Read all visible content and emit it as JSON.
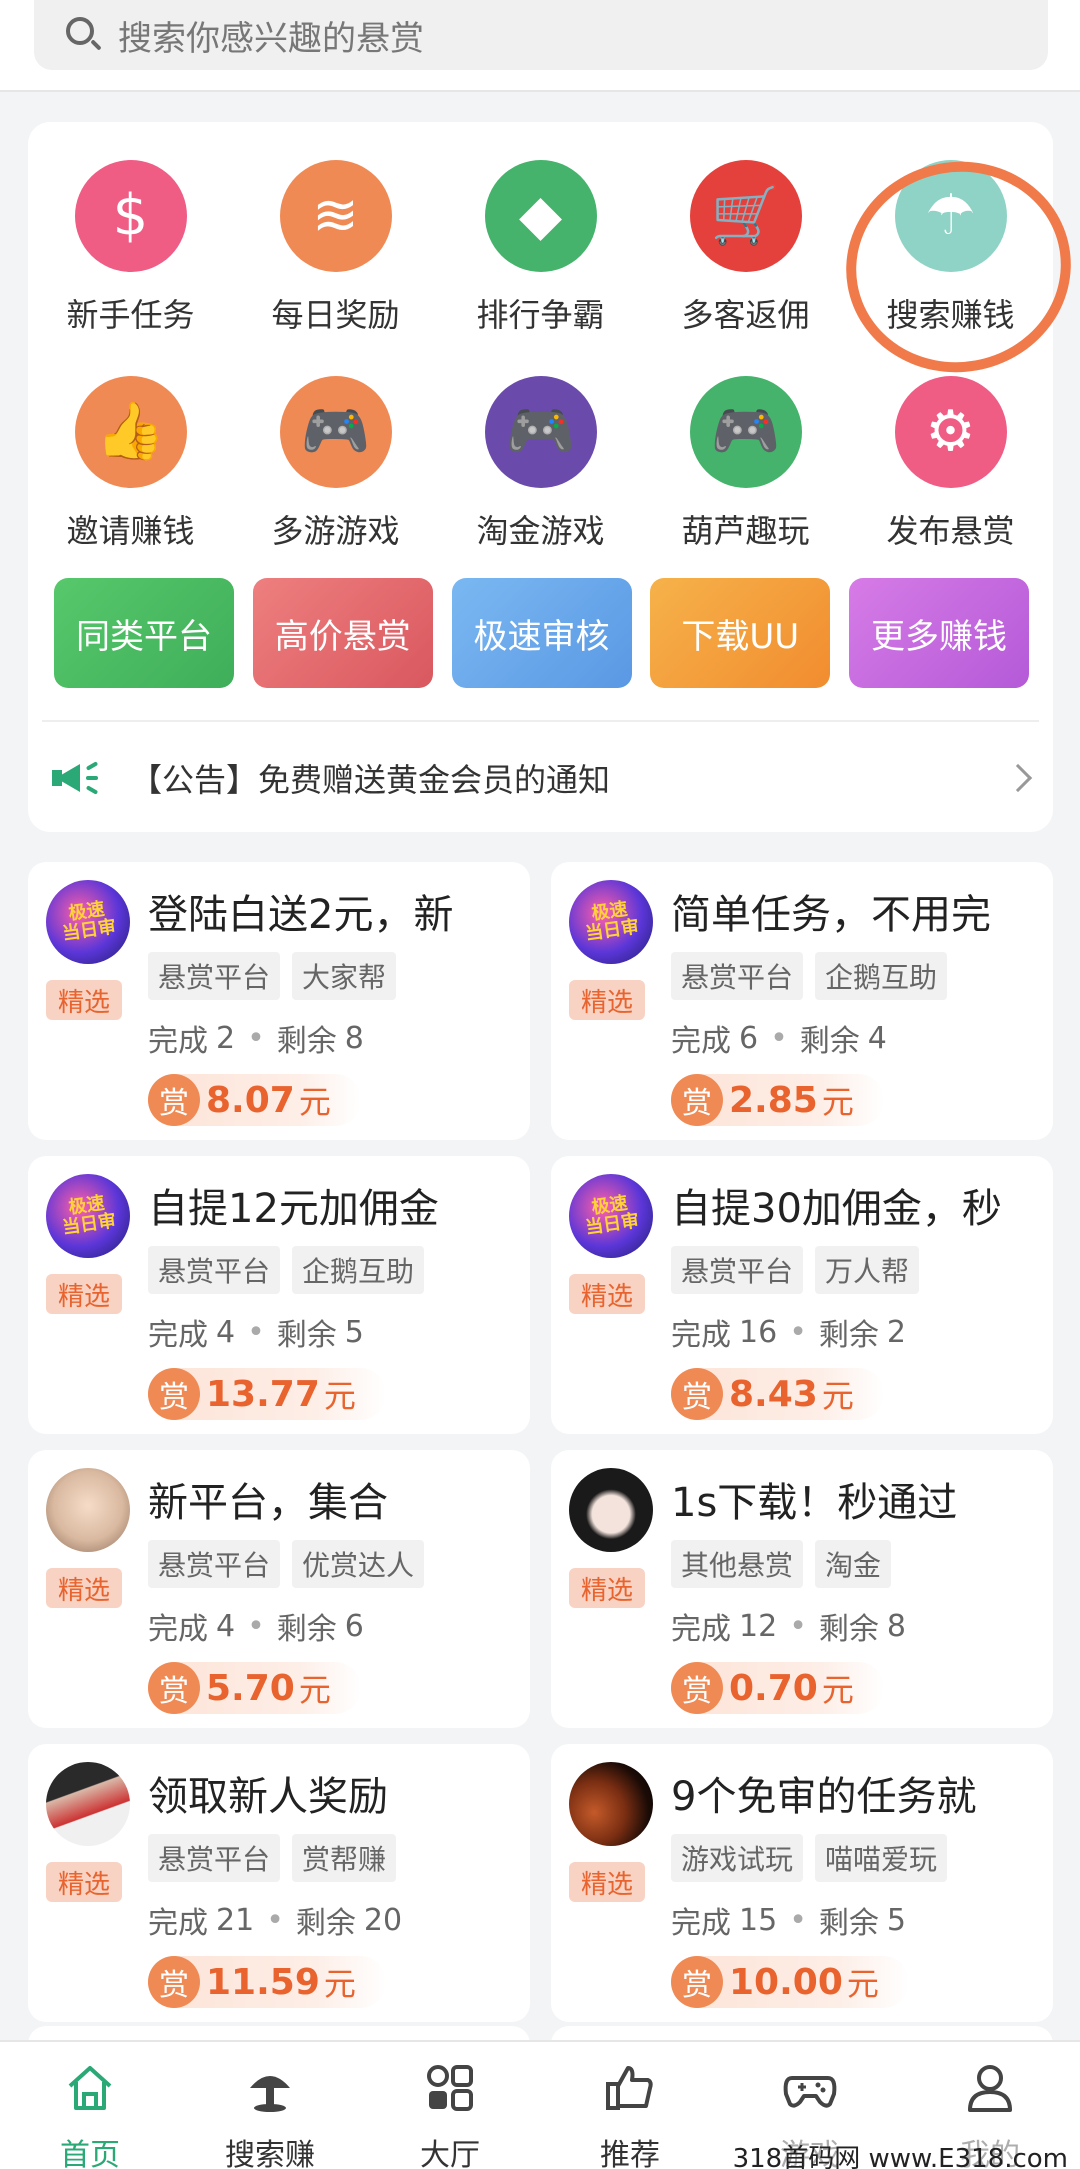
{
  "search": {
    "placeholder": "搜索你感兴趣的悬赏"
  },
  "features": [
    {
      "label": "新手任务",
      "color": "#ef5c84",
      "glyph": "$",
      "icon": "money-bag-icon"
    },
    {
      "label": "每日奖励",
      "color": "#f08a55",
      "glyph": "≋",
      "icon": "coins-stack-icon"
    },
    {
      "label": "排行争霸",
      "color": "#45b36b",
      "glyph": "◆",
      "icon": "diamond-icon"
    },
    {
      "label": "多客返佣",
      "color": "#e5413c",
      "glyph": "🛒",
      "icon": "cart-icon"
    },
    {
      "label": "搜索赚钱",
      "color": "#8fd3c6",
      "glyph": "☂",
      "icon": "search-earn-icon"
    },
    {
      "label": "邀请赚钱",
      "color": "#f08a55",
      "glyph": "👍",
      "icon": "thumbs-up-icon"
    },
    {
      "label": "多游游戏",
      "color": "#f08a55",
      "glyph": "🎮",
      "icon": "gamepad-icon"
    },
    {
      "label": "淘金游戏",
      "color": "#6a4bab",
      "glyph": "🎮",
      "icon": "gamepad-icon"
    },
    {
      "label": "葫芦趣玩",
      "color": "#45b36b",
      "glyph": "🎮",
      "icon": "gamepad-icon"
    },
    {
      "label": "发布悬赏",
      "color": "#ef5c84",
      "glyph": "⚙",
      "icon": "share-nodes-icon"
    }
  ],
  "pills": [
    {
      "label": "同类平台",
      "from": "#57c86b",
      "to": "#3fae5a"
    },
    {
      "label": "高价悬赏",
      "from": "#ee7f7f",
      "to": "#d9585f"
    },
    {
      "label": "极速审核",
      "from": "#7ab8f2",
      "to": "#5a98e4"
    },
    {
      "label": "下载UU",
      "from": "#f6b24a",
      "to": "#f18c2f"
    },
    {
      "label": "更多赚钱",
      "from": "#d67be6",
      "to": "#b55ad8"
    }
  ],
  "notice": {
    "text": "【公告】免费赠送黄金会员的通知"
  },
  "tasks": [
    {
      "title": "登陆白送2元，新",
      "tags": [
        "悬赏平台",
        "大家帮"
      ],
      "done_label": "完成",
      "done": "2",
      "left_label": "剩余",
      "left": "8",
      "reward": "8.07",
      "avatar": "brand",
      "avatar_text": "极速\n当日审"
    },
    {
      "title": "简单任务，不用完",
      "tags": [
        "悬赏平台",
        "企鹅互助"
      ],
      "done_label": "完成",
      "done": "6",
      "left_label": "剩余",
      "left": "4",
      "reward": "2.85",
      "avatar": "brand",
      "avatar_text": "极速\n当日审"
    },
    {
      "title": "自提12元加佣金",
      "tags": [
        "悬赏平台",
        "企鹅互助"
      ],
      "done_label": "完成",
      "done": "4",
      "left_label": "剩余",
      "left": "5",
      "reward": "13.77",
      "avatar": "brand",
      "avatar_text": "极速\n当日审"
    },
    {
      "title": "自提30加佣金，秒",
      "tags": [
        "悬赏平台",
        "万人帮"
      ],
      "done_label": "完成",
      "done": "16",
      "left_label": "剩余",
      "left": "2",
      "reward": "8.43",
      "avatar": "brand",
      "avatar_text": "极速\n当日审"
    },
    {
      "title": "新平台，集合",
      "tags": [
        "悬赏平台",
        "优赏达人"
      ],
      "done_label": "完成",
      "done": "4",
      "left_label": "剩余",
      "left": "6",
      "reward": "5.70",
      "avatar": "kid",
      "avatar_text": ""
    },
    {
      "title": "1s下载！秒通过",
      "tags": [
        "其他悬赏",
        "淘金"
      ],
      "done_label": "完成",
      "done": "12",
      "left_label": "剩余",
      "left": "8",
      "reward": "0.70",
      "avatar": "anime",
      "avatar_text": ""
    },
    {
      "title": "领取新人奖励",
      "tags": [
        "悬赏平台",
        "赏帮赚"
      ],
      "done_label": "完成",
      "done": "21",
      "left_label": "剩余",
      "left": "20",
      "reward": "11.59",
      "avatar": "person",
      "avatar_text": ""
    },
    {
      "title": "9个免审的任务就",
      "tags": [
        "游戏试玩",
        "喵喵爱玩"
      ],
      "done_label": "完成",
      "done": "15",
      "left_label": "剩余",
      "left": "5",
      "reward": "10.00",
      "avatar": "planet",
      "avatar_text": ""
    }
  ],
  "task_common": {
    "badge": "精选",
    "coin": "赏",
    "unit": "元"
  },
  "nav": [
    {
      "label": "首页",
      "icon": "home-icon",
      "active": true
    },
    {
      "label": "搜索赚",
      "icon": "search-earn-icon",
      "active": false
    },
    {
      "label": "大厅",
      "icon": "hall-icon",
      "active": false
    },
    {
      "label": "推荐",
      "icon": "thumbs-up-icon",
      "active": false
    },
    {
      "label": "游戏",
      "icon": "gamepad-icon",
      "active": false
    },
    {
      "label": "我的",
      "icon": "user-icon",
      "active": false
    }
  ],
  "watermark": "318首码网 www.E318.com"
}
